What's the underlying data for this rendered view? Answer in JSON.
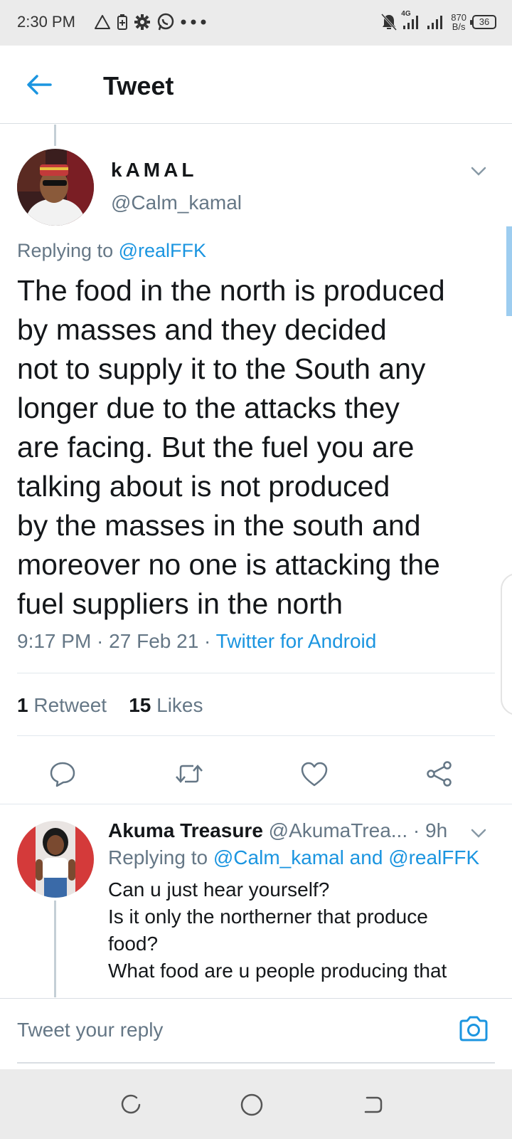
{
  "status_bar": {
    "time": "2:30 PM",
    "network_type": "4G",
    "net_speed_value": "870",
    "net_speed_unit": "B/s",
    "battery": "36",
    "icons_left": [
      "warning-icon",
      "battery-saver-icon",
      "settings-icon",
      "whatsapp-icon",
      "more-dots-icon"
    ],
    "icons_right": [
      "mute-icon",
      "signal-icon",
      "signal-icon",
      "battery-icon"
    ]
  },
  "header": {
    "title": "Tweet",
    "back_icon": "arrow-left-icon"
  },
  "tweet": {
    "display_name": "kAMAL",
    "handle": "@Calm_kamal",
    "replying_prefix": "Replying to ",
    "replying_to": "@realFFK",
    "text": "The food in the north is produced\nby masses and they decided\nnot to supply it to the South any\nlonger due to the attacks they\nare facing. But the fuel you are\ntalking about is not produced\nby the masses in the south and\nmoreover no one is attacking the\nfuel suppliers in the north",
    "time": "9:17 PM",
    "separator": " · ",
    "date": "27 Feb 21",
    "source": "Twitter for Android",
    "retweet_count": "1",
    "retweet_label": "Retweet",
    "likes_count": "15",
    "likes_label": "Likes"
  },
  "actions": [
    "reply-icon",
    "retweet-icon",
    "like-icon",
    "share-icon"
  ],
  "reply": {
    "display_name": "Akuma Treasure",
    "handle": "@AkumaTrea...",
    "time": "· 9h",
    "replying_prefix": "Replying to ",
    "replying_to_1": "@Calm_kamal",
    "replying_and": " and ",
    "replying_to_2": "@realFFK",
    "lines": [
      "Can u just hear yourself?",
      "Is it only the northerner that produce",
      "food?",
      "What food are u people producing that"
    ]
  },
  "compose": {
    "placeholder": "Tweet your reply",
    "camera_icon": "camera-icon"
  },
  "colors": {
    "accent": "#1b95e0",
    "text": "#14171a",
    "muted": "#657786",
    "divider": "#e1e8ed"
  }
}
